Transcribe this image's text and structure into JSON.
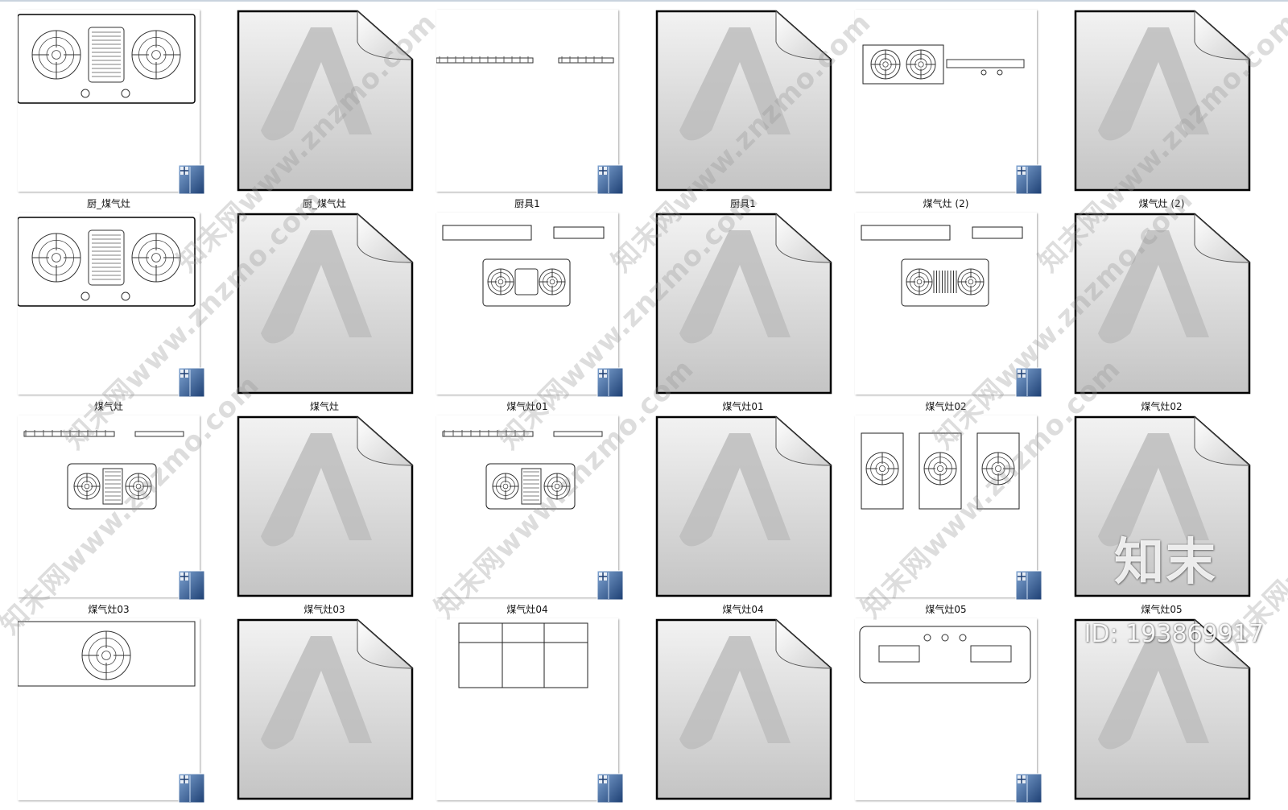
{
  "files": [
    {
      "name": "厨_煤气灶",
      "type": "dwg",
      "preview": "stove-top"
    },
    {
      "name": "厨_煤气灶",
      "type": "generic"
    },
    {
      "name": "厨具1",
      "type": "dwg",
      "preview": "lines"
    },
    {
      "name": "厨具1",
      "type": "generic"
    },
    {
      "name": "煤气灶 (2)",
      "type": "dwg",
      "preview": "side-stove"
    },
    {
      "name": "煤气灶 (2)",
      "type": "generic"
    },
    {
      "name": "煤气灶",
      "type": "dwg",
      "preview": "stove-top"
    },
    {
      "name": "煤气灶",
      "type": "generic"
    },
    {
      "name": "煤气灶01",
      "type": "dwg",
      "preview": "stove-set"
    },
    {
      "name": "煤气灶01",
      "type": "generic"
    },
    {
      "name": "煤气灶02",
      "type": "dwg",
      "preview": "stove-set2"
    },
    {
      "name": "煤气灶02",
      "type": "generic"
    },
    {
      "name": "煤气灶03",
      "type": "dwg",
      "preview": "stove-small"
    },
    {
      "name": "煤气灶03",
      "type": "generic"
    },
    {
      "name": "煤气灶04",
      "type": "dwg",
      "preview": "stove-small2"
    },
    {
      "name": "煤气灶04",
      "type": "generic"
    },
    {
      "name": "煤气灶05",
      "type": "dwg",
      "preview": "triple"
    },
    {
      "name": "煤气灶05",
      "type": "generic"
    },
    {
      "name": "",
      "type": "dwg",
      "preview": "partial-circle"
    },
    {
      "name": "",
      "type": "generic"
    },
    {
      "name": "",
      "type": "dwg",
      "preview": "partial-box"
    },
    {
      "name": "",
      "type": "generic"
    },
    {
      "name": "",
      "type": "dwg",
      "preview": "partial-stove"
    },
    {
      "name": "",
      "type": "generic"
    }
  ],
  "watermark": {
    "text": "知末网www.znzmo.com",
    "logo": "知末",
    "id": "ID: 193869917"
  },
  "colors": {
    "badge_blue": "#2d5f9e",
    "generic_gray": "#d6d6d6"
  },
  "icons": {
    "dwg": "autocad-dwg-icon",
    "generic": "autodesk-file-icon"
  }
}
